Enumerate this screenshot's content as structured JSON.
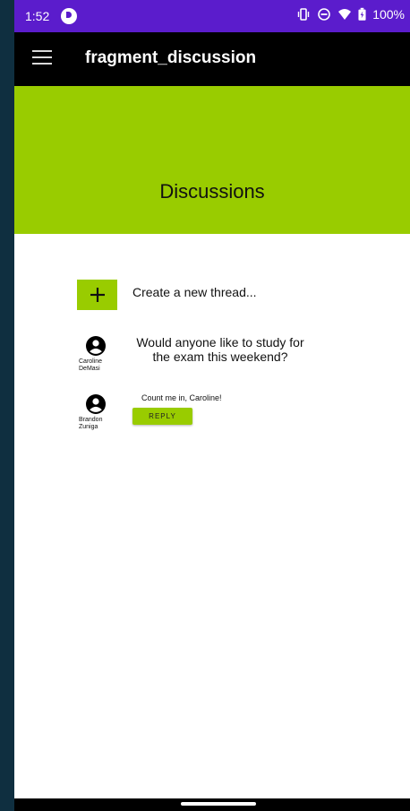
{
  "status_bar": {
    "time": "1:52",
    "battery": "100%"
  },
  "app_bar": {
    "title": "fragment_discussion"
  },
  "banner": {
    "title": "Discussions"
  },
  "create_thread": {
    "label": "Create a new thread..."
  },
  "thread": {
    "author": "Caroline DeMasi",
    "message": "Would anyone like to study for the exam this weekend?"
  },
  "reply": {
    "author": "Brandon Zuniga",
    "message": "Count me in, Caroline!",
    "button_label": "REPLY"
  },
  "colors": {
    "status_bar": "#5b1ccc",
    "accent": "#99cc00",
    "app_bar": "#000000",
    "background": "#0f2f40"
  }
}
